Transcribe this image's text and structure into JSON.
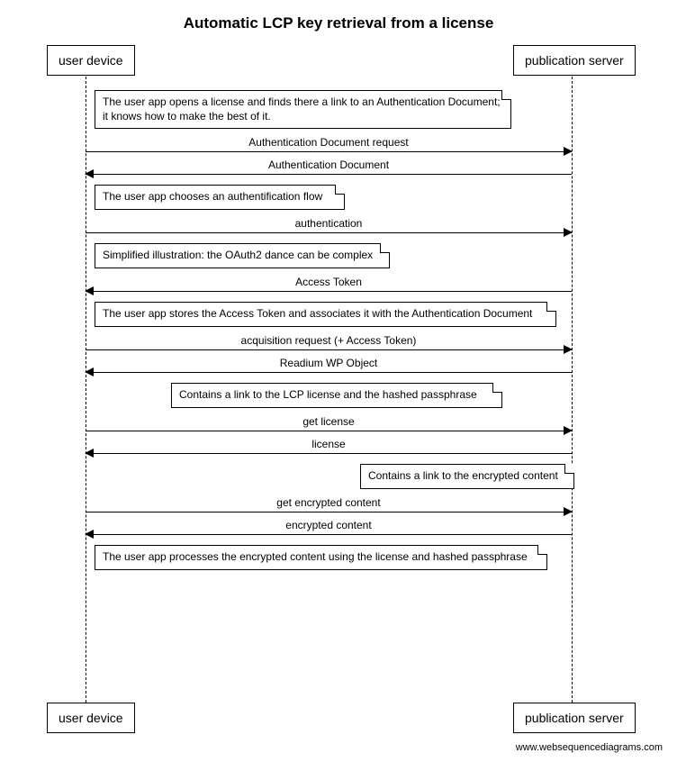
{
  "title": "Automatic LCP key retrieval from a license",
  "actors": {
    "left": "user device",
    "right": "publication server"
  },
  "notes": {
    "n1": "The user app opens a license and finds there a link to an Authentication Document; it knows how to make the best of it.",
    "n2": "The user app chooses an authentification flow",
    "n3": "Simplified illustration: the OAuth2 dance can be complex",
    "n4": "The user app stores the Access Token and associates it with the Authentication Document",
    "n5": "Contains a link to the LCP license and the hashed passphrase",
    "n6": "Contains a link to the encrypted content",
    "n7": "The user app processes the encrypted content using the license and hashed passphrase"
  },
  "messages": {
    "m1": "Authentication Document request",
    "m2": "Authentication Document",
    "m3": "authentication",
    "m4": "Access Token",
    "m5": "acquisition request (+ Access Token)",
    "m6": "Readium WP Object",
    "m7": "get license",
    "m8": "license",
    "m9": "get encrypted content",
    "m10": "encrypted content"
  },
  "credit": "www.websequencediagrams.com"
}
